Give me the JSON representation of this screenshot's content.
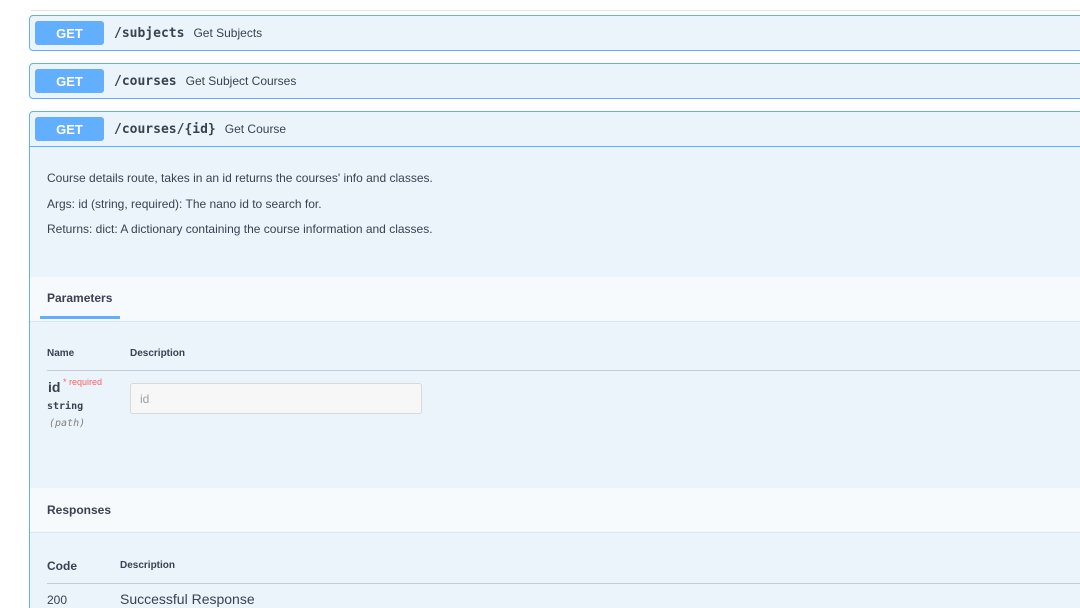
{
  "endpoints": [
    {
      "method": "GET",
      "path": "/subjects",
      "summary": "Get Subjects"
    },
    {
      "method": "GET",
      "path": "/courses",
      "summary": "Get Subject Courses"
    },
    {
      "method": "GET",
      "path": "/courses/{id}",
      "summary": "Get Course"
    }
  ],
  "expanded": {
    "description_lines": [
      "Course details route, takes in an id returns the courses' info and classes.",
      "Args: id (string, required): The nano id to search for.",
      "Returns: dict: A dictionary containing the course information and classes."
    ],
    "parameters_tab": "Parameters",
    "param_table": {
      "name_header": "Name",
      "description_header": "Description",
      "param": {
        "name": "id",
        "required_mark": "* required",
        "type": "string",
        "in": "(path)",
        "placeholder": "id"
      }
    },
    "responses_title": "Responses",
    "responses_table": {
      "code_header": "Code",
      "description_header": "Description",
      "rows": [
        {
          "code": "200",
          "description": "Successful Response"
        }
      ]
    }
  },
  "colors": {
    "get_badge": "#61affe",
    "block_bg": "#ebf3fb",
    "required": "#ff6060"
  }
}
